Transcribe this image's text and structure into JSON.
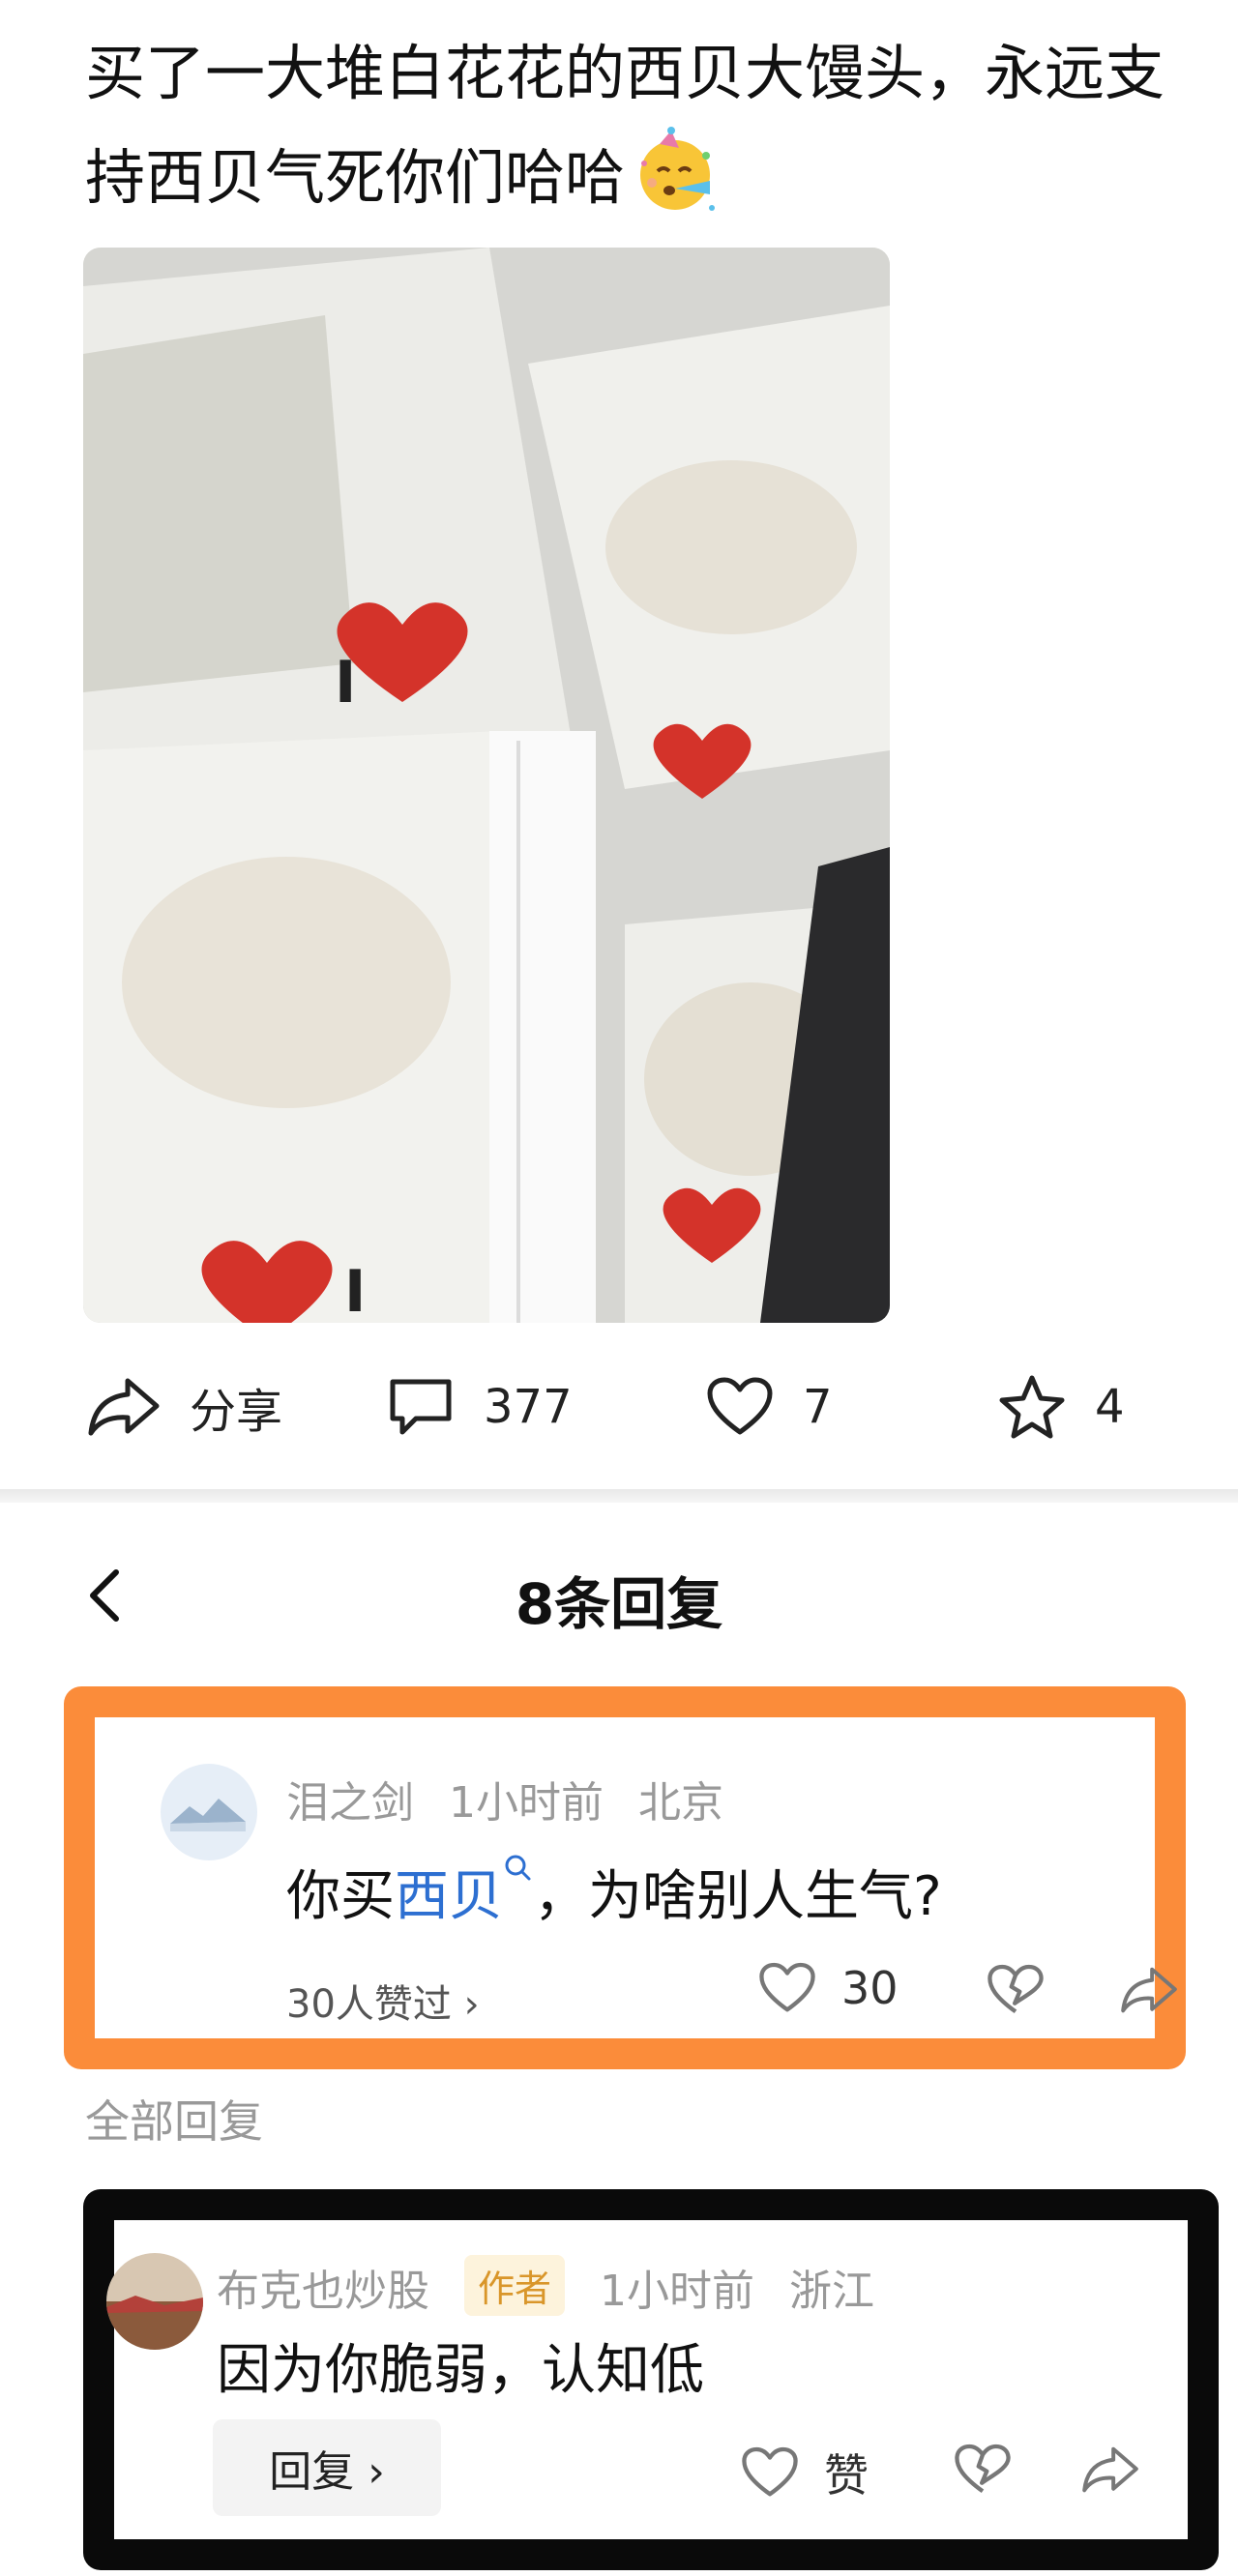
{
  "post": {
    "text": "买了一大堆白花花的西贝大馒头，永远支持西贝气死你们哈哈",
    "emoji": "party-face-emoji",
    "image_alt": "photo of steamed buns in I love XIBEI bags"
  },
  "actions": {
    "share_label": "分享",
    "comments_count": "377",
    "likes_count": "7",
    "favorites_count": "4"
  },
  "replies_panel": {
    "title": "8条回复",
    "all_replies_label": "全部回复"
  },
  "highlighted_comment": {
    "username": "泪之剑",
    "time": "1小时前",
    "location": "北京",
    "text_before": "你买",
    "link_word": "西贝",
    "text_after": "，为啥别人生气?",
    "likers": "30人赞过 ›",
    "like_count": "30"
  },
  "reply": {
    "username": "布克也炒股",
    "author_tag": "作者",
    "time": "1小时前",
    "location": "浙江",
    "text": "因为你脆弱，认知低",
    "reply_button_label": "回复 ›",
    "like_label": "赞"
  },
  "colors": {
    "highlight_border": "#fb8c3a",
    "dark_border": "#0a0a0a",
    "link": "#2d6fd1",
    "author_tag_text": "#d9962a"
  }
}
